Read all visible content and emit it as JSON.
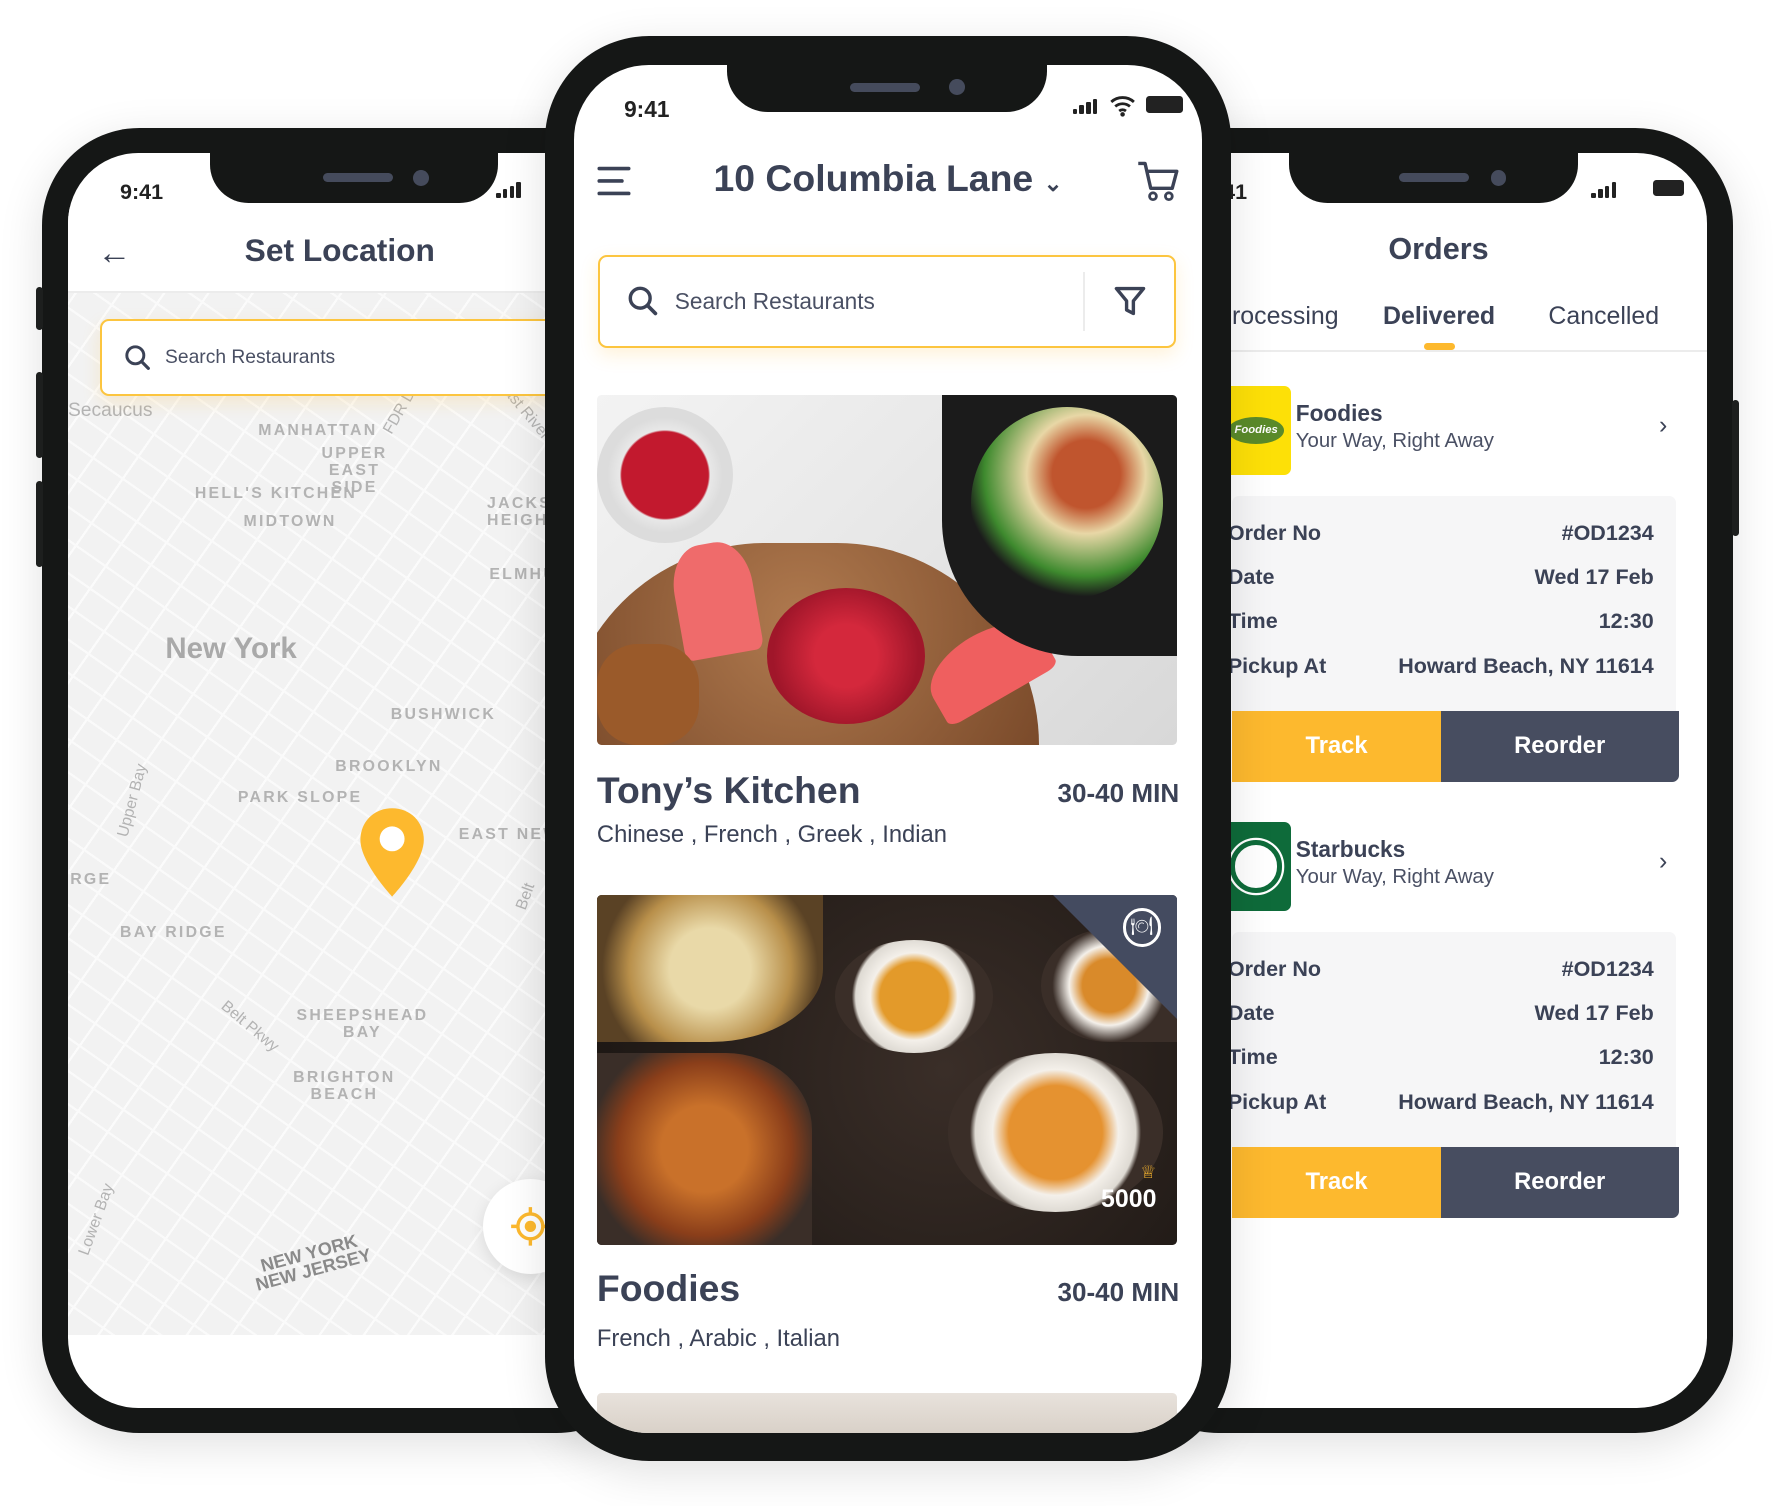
{
  "status_time": "9:41",
  "left_screen": {
    "title": "Set Location",
    "search_placeholder": "Search Restaurants",
    "map_labels": [
      "Secaucus",
      "MANHATTAN",
      "UPPER EAST SIDE",
      "HELL'S KITCHEN",
      "MIDTOWN",
      "JACKSON HEIGHTS",
      "ELMHURST",
      "New York",
      "BUSHWICK",
      "BROOKLYN",
      "PARK SLOPE",
      "EAST NEW",
      "Upper Bay",
      "RGE",
      "BAY RIDGE",
      "SHEEPSHEAD BAY",
      "Belt Pkwy",
      "BRIGHTON BEACH",
      "Lower Bay",
      "NEW YORK NEW JERSEY",
      "FDR Dr",
      "East River",
      "Belt"
    ],
    "pin_color": "#fdb92e"
  },
  "center_screen": {
    "address": "10 Columbia Lane",
    "search_placeholder": "Search Restaurants",
    "restaurants": [
      {
        "name": "Tony’s Kitchen",
        "time": "30-40 MIN",
        "cuisines": "Chinese , French , Greek , Indian"
      },
      {
        "name": "Foodies",
        "time": "30-40 MIN",
        "cuisines": "French , Arabic , Italian",
        "points": "5000"
      }
    ]
  },
  "right_screen": {
    "title": "Orders",
    "tabs": [
      {
        "label": "Processing"
      },
      {
        "label": "Delivered",
        "active": true
      },
      {
        "label": "Cancelled"
      }
    ],
    "orders": [
      {
        "name": "Foodies",
        "tagline": "Your Way, Right Away",
        "logo_text": "Foodies",
        "rows": [
          {
            "label": "Order No",
            "value": "#OD1234"
          },
          {
            "label": "Date",
            "value": "Wed 17 Feb"
          },
          {
            "label": "Time",
            "value": "12:30"
          },
          {
            "label": "Pickup At",
            "value": "Howard Beach, NY 11614"
          }
        ],
        "track": "Track",
        "reorder": "Reorder"
      },
      {
        "name": "Starbucks",
        "tagline": "Your Way, Right Away",
        "rows": [
          {
            "label": "Order No",
            "value": "#OD1234"
          },
          {
            "label": "Date",
            "value": "Wed 17 Feb"
          },
          {
            "label": "Time",
            "value": "12:30"
          },
          {
            "label": "Pickup At",
            "value": "Howard Beach, NY 11614"
          }
        ],
        "track": "Track",
        "reorder": "Reorder"
      }
    ]
  },
  "colors": {
    "accent": "#fdb92e",
    "dark": "#474d60",
    "text": "#3b4256"
  }
}
